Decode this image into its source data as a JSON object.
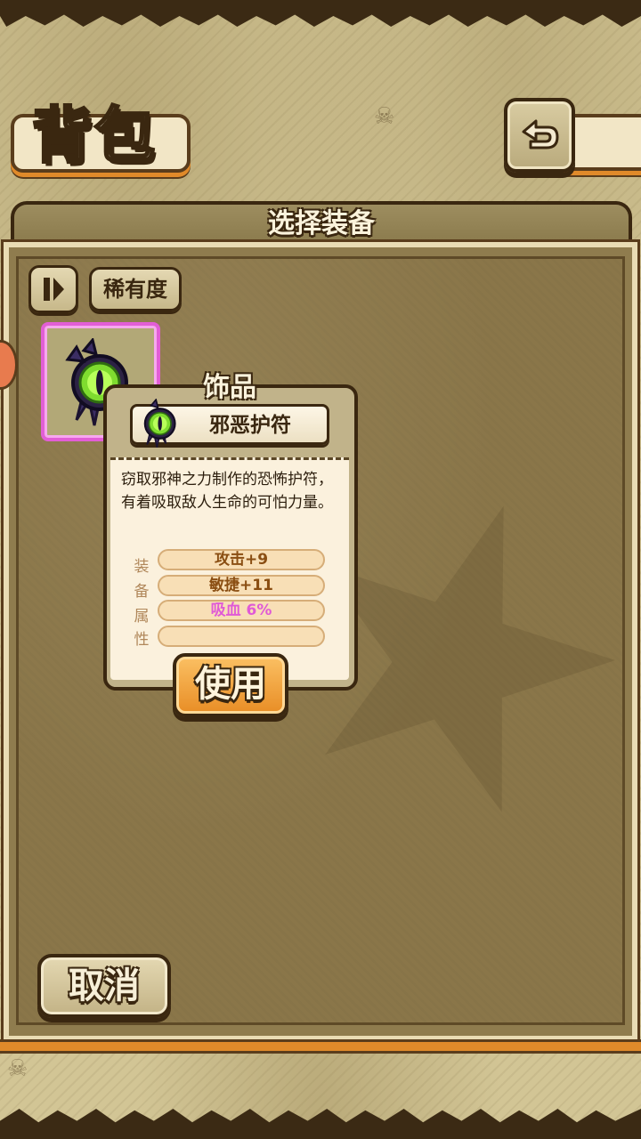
{
  "header": {
    "title": "背包",
    "back_icon": "return-arrow-icon"
  },
  "panel": {
    "title": "选择装备",
    "sort_icon": "sort-toggle-icon",
    "sort_rarity_label": "稀有度"
  },
  "inventory": {
    "items": [
      {
        "icon": "evil-amulet-icon",
        "rarity_color": "#e25ed6"
      }
    ]
  },
  "tooltip": {
    "category": "饰品",
    "item_name": "邪恶护符",
    "description": "窃取邪神之力制作的恐怖护符，有着吸取敌人生命的可怕力量。",
    "attr_labels": [
      "装",
      "备",
      "属",
      "性"
    ],
    "attributes": [
      "攻击+9",
      "敏捷+11",
      "吸血 6%",
      ""
    ],
    "use_label": "使用"
  },
  "footer": {
    "cancel_label": "取消"
  },
  "colors": {
    "accent_orange": "#e88d25",
    "rarity_purple": "#e25ed6",
    "panel_brown": "#8a7649"
  }
}
